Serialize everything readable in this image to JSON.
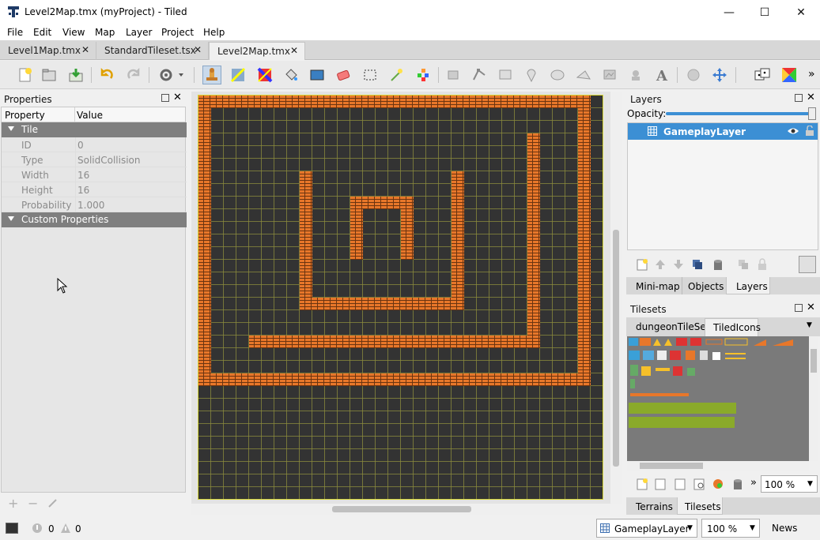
{
  "window": {
    "title": "Level2Map.tmx (myProject) - Tiled",
    "minimize": "—",
    "maximize": "☐",
    "close": "✕"
  },
  "menu": [
    "File",
    "Edit",
    "View",
    "Map",
    "Layer",
    "Project",
    "Help"
  ],
  "tabs": [
    {
      "label": "Level1Map.tmx",
      "close": "✕"
    },
    {
      "label": "StandardTileset.tsx",
      "close": "✕"
    },
    {
      "label": "Level2Map.tmx",
      "close": "✕"
    }
  ],
  "toolbar_overflow": "»",
  "properties": {
    "title": "Properties",
    "col_property": "Property",
    "col_value": "Value",
    "group_tile": "Tile",
    "rows": [
      {
        "key": "ID",
        "value": "0"
      },
      {
        "key": "Type",
        "value": "SolidCollision"
      },
      {
        "key": "Width",
        "value": "16"
      },
      {
        "key": "Height",
        "value": "16"
      },
      {
        "key": "Probability",
        "value": "1.000"
      }
    ],
    "group_custom": "Custom Properties",
    "footer": {
      "add": "+",
      "remove": "−"
    }
  },
  "layers": {
    "title": "Layers",
    "opacity_label": "Opacity:",
    "opacity": 1.0,
    "items": [
      {
        "name": "GameplayLayer"
      }
    ],
    "tabs": [
      "Mini-map",
      "Objects",
      "Layers"
    ]
  },
  "tilesets": {
    "title": "Tilesets",
    "tabs": [
      "dungeonTileSet",
      "TiledIcons"
    ],
    "zoom": "100 %",
    "overflow": "»",
    "bottom_tabs": [
      "Terrains",
      "Tilesets"
    ]
  },
  "status": {
    "errors": "0",
    "warnings": "0",
    "layer": "GameplayLayer",
    "zoom": "100 %",
    "news": "News"
  },
  "colors": {
    "accent": "#3c8fd4",
    "brick": "#e8772a",
    "map_bg": "#333333",
    "grid": "#8c8c3c"
  }
}
